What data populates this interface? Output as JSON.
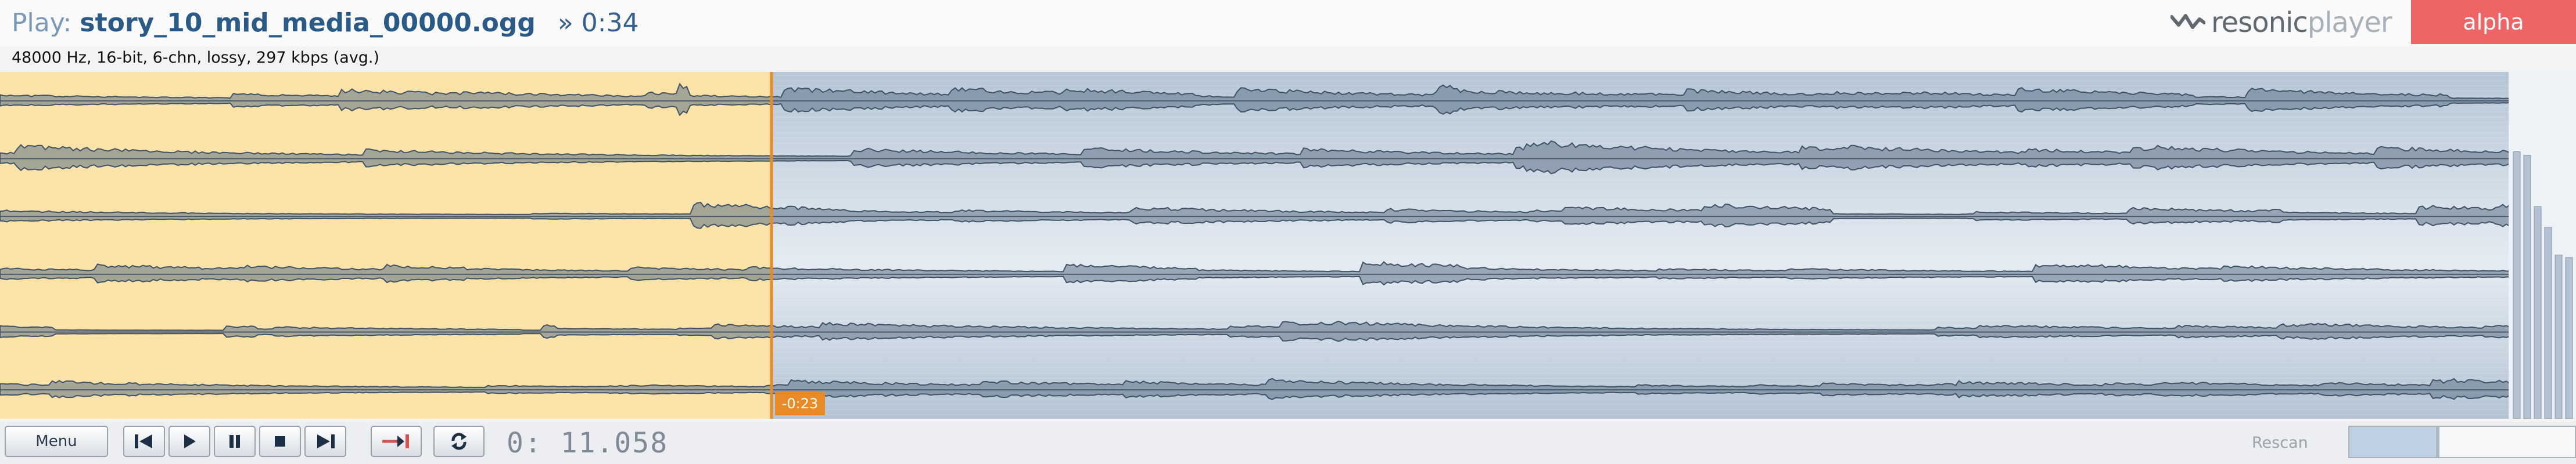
{
  "header": {
    "play_label": "Play:",
    "file_name": "story_10_mid_media_00000.ogg",
    "duration": "» 0:34",
    "logo_main": "resonic",
    "logo_sub": "player",
    "badge": "alpha"
  },
  "info": "48000 Hz, 16-bit, 6-chn, lossy, 297 kbps (avg.)",
  "waveform": {
    "channels": 6,
    "played_fraction": 0.3067,
    "cursor_label": "-0:23",
    "played_color": "#fbe2a6",
    "unplayed_color": "#9fb4c9",
    "cursor_color": "#e88a26",
    "end_marker_color": "#d85050",
    "channel_levels": [
      0.7,
      0.75,
      0.55,
      0.5,
      0.4,
      0.45
    ]
  },
  "controls": {
    "menu_label": "Menu",
    "time": "0: 11.058",
    "rescan_label": "Rescan",
    "rescan_level": 0.4
  }
}
